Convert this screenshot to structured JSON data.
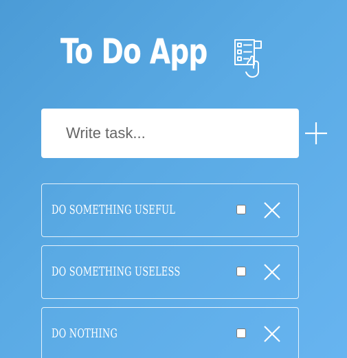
{
  "header": {
    "title": "To Do App",
    "icon": "task-list-icon"
  },
  "input": {
    "placeholder": "Write task...",
    "value": "",
    "add_icon": "plus-icon"
  },
  "tasks": [
    {
      "text": "Do something useful",
      "done": false,
      "delete_icon": "close-icon"
    },
    {
      "text": "Do something useless",
      "done": false,
      "delete_icon": "close-icon"
    },
    {
      "text": "Do nothing",
      "done": false,
      "delete_icon": "close-icon"
    }
  ],
  "colors": {
    "background_start": "#4b9bd6",
    "background_end": "#67b4f0",
    "foreground": "#ffffff"
  }
}
